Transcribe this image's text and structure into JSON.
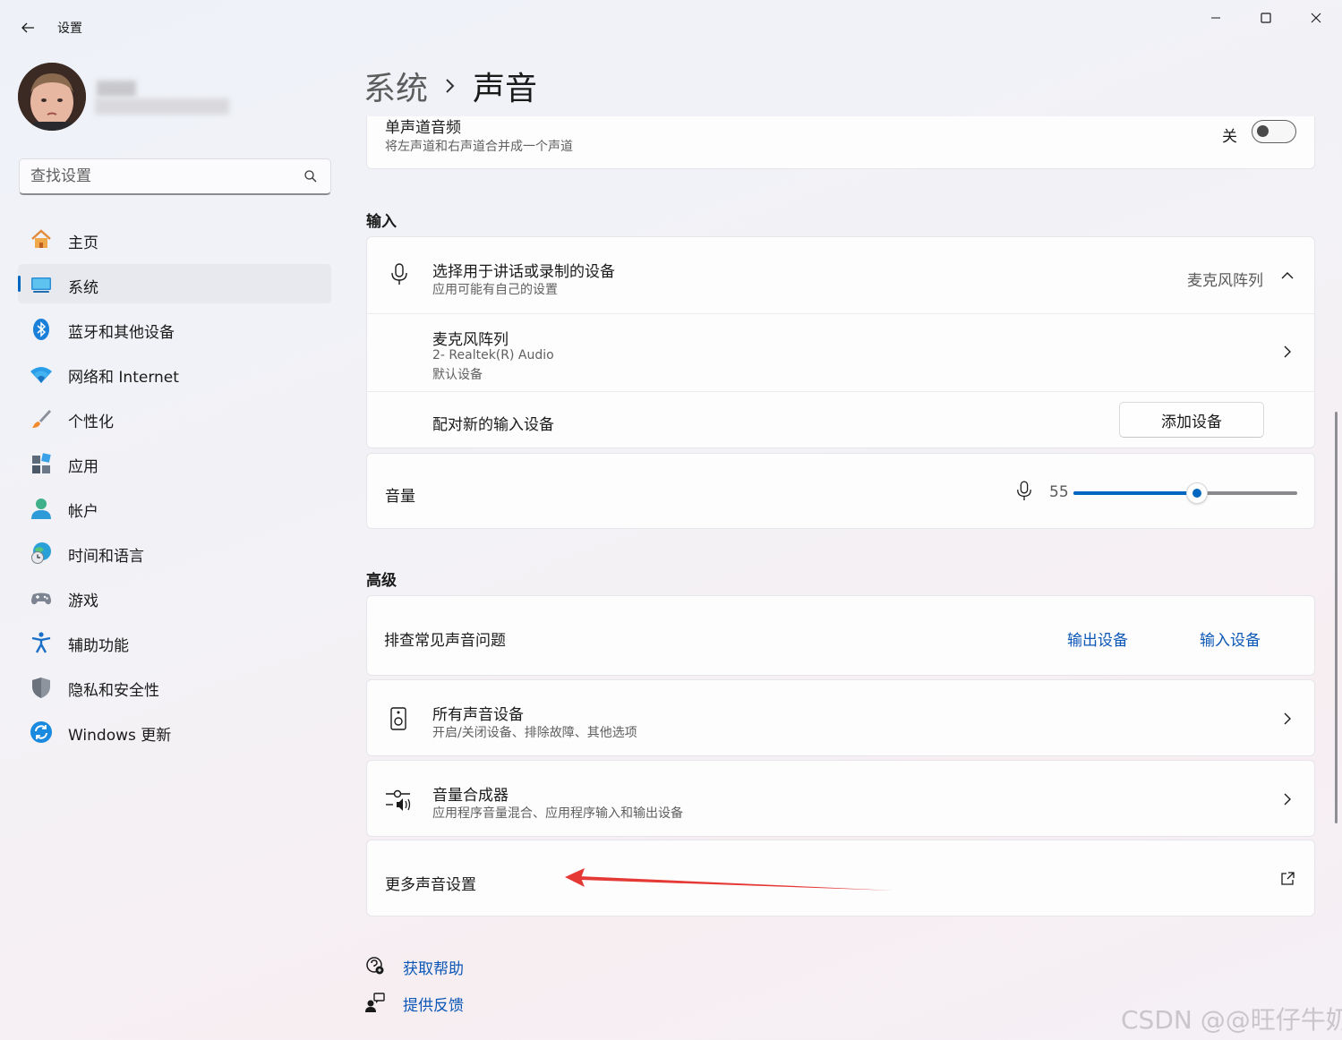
{
  "window": {
    "title": "设置",
    "controls": [
      "minimize-icon",
      "maximize-icon",
      "close-icon"
    ]
  },
  "search": {
    "placeholder": "查找设置"
  },
  "sidebar": {
    "items": [
      {
        "label": "主页",
        "icon": "home-icon",
        "active": false
      },
      {
        "label": "系统",
        "icon": "system-icon",
        "active": true
      },
      {
        "label": "蓝牙和其他设备",
        "icon": "bluetooth-icon",
        "active": false
      },
      {
        "label": "网络和 Internet",
        "icon": "wifi-icon",
        "active": false
      },
      {
        "label": "个性化",
        "icon": "brush-icon",
        "active": false
      },
      {
        "label": "应用",
        "icon": "apps-icon",
        "active": false
      },
      {
        "label": "帐户",
        "icon": "account-icon",
        "active": false
      },
      {
        "label": "时间和语言",
        "icon": "globe-clock-icon",
        "active": false
      },
      {
        "label": "游戏",
        "icon": "gamepad-icon",
        "active": false
      },
      {
        "label": "辅助功能",
        "icon": "accessibility-icon",
        "active": false
      },
      {
        "label": "隐私和安全性",
        "icon": "shield-icon",
        "active": false
      },
      {
        "label": "Windows 更新",
        "icon": "update-icon",
        "active": false
      }
    ]
  },
  "breadcrumb": {
    "parent": "系统",
    "current": "声音"
  },
  "mono": {
    "title": "单声道音频",
    "subtitle": "将左声道和右声道合并成一个声道",
    "state_label": "关",
    "on": false
  },
  "input_section": {
    "heading": "输入",
    "select": {
      "title": "选择用于讲话或录制的设备",
      "subtitle": "应用可能有自己的设置",
      "value": "麦克风阵列"
    },
    "device": {
      "name": "麦克风阵列",
      "driver": "2- Realtek(R) Audio",
      "status": "默认设备"
    },
    "pair": {
      "label": "配对新的输入设备",
      "button": "添加设备"
    },
    "volume": {
      "label": "音量",
      "value": "55",
      "level": 55
    }
  },
  "advanced_section": {
    "heading": "高级",
    "troubleshoot": {
      "label": "排查常见声音问题",
      "output_link": "输出设备",
      "input_link": "输入设备"
    },
    "all_devices": {
      "title": "所有声音设备",
      "subtitle": "开启/关闭设备、排除故障、其他选项"
    },
    "mixer": {
      "title": "音量合成器",
      "subtitle": "应用程序音量混合、应用程序输入和输出设备"
    },
    "more": {
      "label": "更多声音设置"
    }
  },
  "footer": {
    "help": "获取帮助",
    "feedback": "提供反馈"
  },
  "watermark": "CSDN @@旺仔牛奶",
  "colors": {
    "accent": "#0067c0",
    "link": "#0b57b6",
    "arrow": "#e53935"
  }
}
